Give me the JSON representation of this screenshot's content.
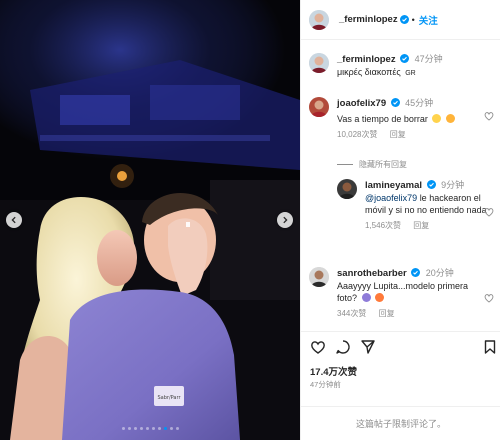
{
  "post": {
    "author": "_ferminlopez",
    "follow_label": "关注",
    "separator": "•",
    "caption_author": "_ferminlopez",
    "caption_time": "47分钟",
    "caption_text": "μικρές διακοπές",
    "caption_lang": "GR",
    "carousel": {
      "total": 10,
      "active_index": 7
    },
    "likes": "17.4万次赞",
    "age": "47分钟前",
    "comments_disabled": "这篇帖子限制评论了。"
  },
  "comments": [
    {
      "user": "joaofelix79",
      "time": "45分钟",
      "text": "Vas a tiempo de borrar",
      "likes": "10,028次赞",
      "reply_label": "回复",
      "emojis": [
        "grimacing-face",
        "laughing-face"
      ]
    },
    {
      "hidden_replies_label": "隐藏所有回复"
    },
    {
      "user": "lamineyamal",
      "time": "9分钟",
      "mention": "@joaofelix79",
      "text": "le hackearon el móvil y si no no entiendo nada",
      "likes": "1,546次赞",
      "reply_label": "回复"
    },
    {
      "user": "sanrothebarber",
      "time": "20分钟",
      "text": "Aaayyyy Lupita...modelo primera foto?",
      "likes": "344次赞",
      "reply_label": "回复",
      "emojis": [
        "person-raising-hand",
        "hot-face"
      ]
    }
  ],
  "icons": {
    "verified": "verified-badge-icon",
    "like": "heart-icon",
    "comment": "comment-icon",
    "share": "send-icon",
    "save": "bookmark-icon",
    "prev": "chevron-left-icon",
    "next": "chevron-right-icon"
  },
  "colors": {
    "accent": "#0095f6",
    "verified": "#0095f6",
    "muted": "#8e8e8e",
    "text": "#262626",
    "mention": "#00376b"
  }
}
